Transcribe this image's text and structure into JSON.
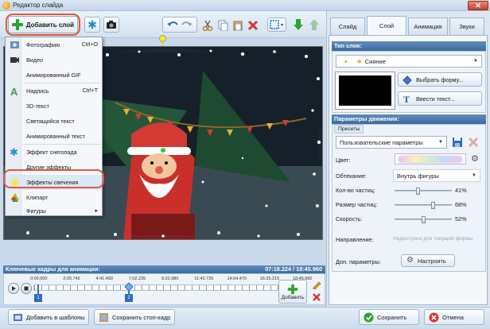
{
  "window": {
    "title": "Редактор слайда",
    "close_symbol": "✕"
  },
  "toolbar": {
    "add_layer_label": "Добавить слой"
  },
  "add_menu": {
    "items": [
      {
        "label": "Фотографию",
        "shortcut": "Ctrl+O",
        "icon": "photo-icon"
      },
      {
        "label": "Видео",
        "shortcut": "",
        "icon": "video-icon"
      },
      {
        "label": "Анимированный GIF",
        "shortcut": "",
        "icon": "none"
      },
      {
        "label": "Надпись",
        "shortcut": "Ctrl+T",
        "icon": "text-a-icon"
      },
      {
        "label": "3D-текст",
        "shortcut": "",
        "icon": "none"
      },
      {
        "label": "Светящийся текст",
        "shortcut": "",
        "icon": "none"
      },
      {
        "label": "Анимированный текст",
        "shortcut": "",
        "icon": "none"
      },
      {
        "label": "Эффект снегопада",
        "shortcut": "",
        "icon": "snowflake-icon"
      },
      {
        "label": "Другие эффекты",
        "shortcut": "",
        "icon": "none"
      },
      {
        "label": "Эффекты свечения",
        "shortcut": "",
        "icon": "glow-icon"
      },
      {
        "label": "Клипарт",
        "shortcut": "",
        "icon": "clipart-icon"
      },
      {
        "label": "Фигуры",
        "shortcut": "▸",
        "icon": "none"
      }
    ]
  },
  "tabs": [
    {
      "label": "Слайд",
      "active": false
    },
    {
      "label": "Слой",
      "active": true
    },
    {
      "label": "Анимация",
      "active": false
    },
    {
      "label": "Звуки",
      "active": false
    }
  ],
  "layer_type": {
    "header": "Тип слоя:",
    "selected": "Сияние",
    "choose_shape_label": "Выбрать форму...",
    "enter_text_label": "Ввести текст..."
  },
  "motion": {
    "header": "Параметры движения:",
    "presets_label": "Пресеты",
    "preset_selected": "Пользовательские параметры",
    "color_label": "Цвет:",
    "flow_label": "Обтекание:",
    "flow_value": "Внутрь фигуры",
    "particles_label": "Кол-во частиц:",
    "particles_value": "41%",
    "particles_level": 0.41,
    "size_label": "Размер частиц:",
    "size_value": "68%",
    "size_level": 0.68,
    "speed_label": "Скорость:",
    "speed_value": "52%",
    "speed_level": 0.52,
    "direction_label": "Направление:",
    "direction_value": "Недоступно для текущей формы",
    "extra_label": "Доп. параметры:",
    "configure_label": "Настроить"
  },
  "timeline": {
    "header": "Ключевые кадры для анимации:",
    "time": "07:18.224 / 18:45.960",
    "ticks": [
      "0:00.000",
      "2:20.745",
      "4:41.490",
      "7:02.235",
      "9:22.980",
      "11:43.725",
      "14:04.470",
      "16:25.215",
      "18:45.960"
    ],
    "keyframe_1": "1",
    "keyframe_2": "2",
    "add_label": "Добавить"
  },
  "bottom": {
    "templates_label": "Добавить в шаблоны",
    "save_frame_label": "Сохранить стоп-кадр",
    "save_label": "Сохранить",
    "cancel_label": "Отмена"
  },
  "colors": {
    "accent": "#3c6a9d",
    "highlight": "#e0593c",
    "green": "#2ea12e",
    "red": "#d13a2c"
  }
}
